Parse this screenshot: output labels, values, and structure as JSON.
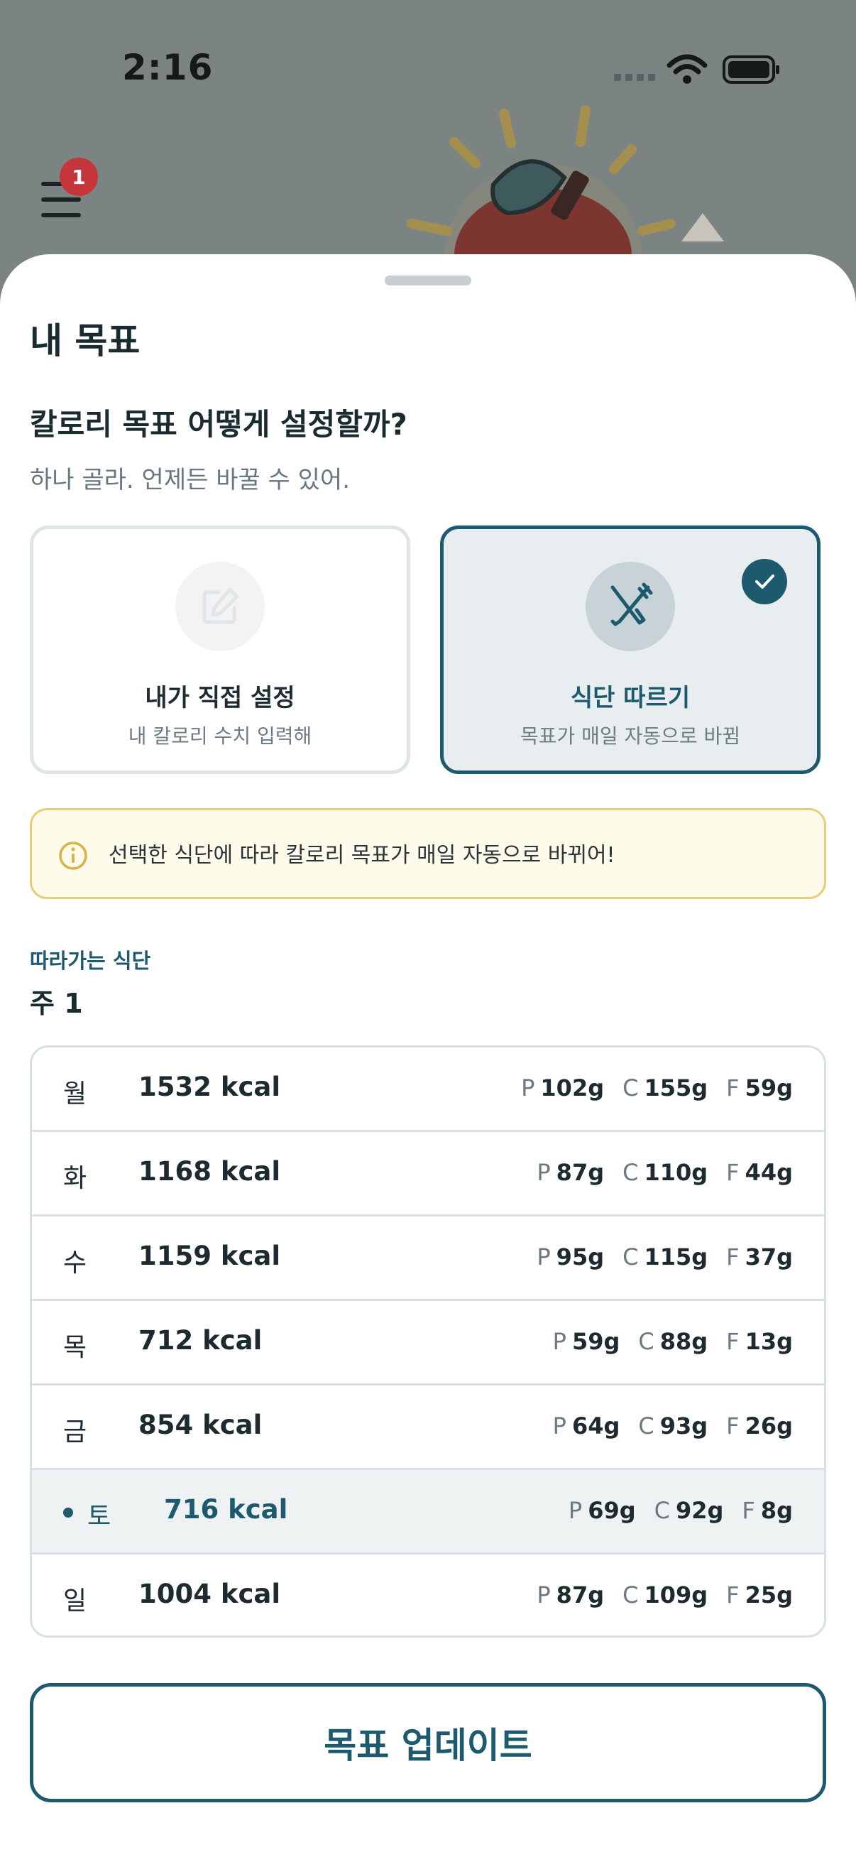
{
  "status_bar": {
    "time": "2:16"
  },
  "menu": {
    "badge_count": "1"
  },
  "sheet": {
    "title": "내 목표",
    "question": "칼로리 목표 어떻게 설정할까?",
    "subtitle": "하나 골라. 언제든 바꿀 수 있어."
  },
  "options": {
    "manual": {
      "title": "내가 직접 설정",
      "subtitle": "내 칼로리 수치 입력해",
      "icon": "edit-icon",
      "selected": false
    },
    "diet": {
      "title": "식단 따르기",
      "subtitle": "목표가 매일 자동으로 바뀜",
      "icon": "utensils-icon",
      "selected": true
    }
  },
  "notice": {
    "text": "선택한 식단에 따라 칼로리 목표가 매일 자동으로 바뀌어!",
    "icon": "info-icon"
  },
  "plan": {
    "label": "따라가는 식단",
    "week": "주 1",
    "days": [
      {
        "day": "월",
        "kcal": "1532 kcal",
        "p": "102g",
        "c": "155g",
        "f": "59g",
        "today": false
      },
      {
        "day": "화",
        "kcal": "1168 kcal",
        "p": "87g",
        "c": "110g",
        "f": "44g",
        "today": false
      },
      {
        "day": "수",
        "kcal": "1159 kcal",
        "p": "95g",
        "c": "115g",
        "f": "37g",
        "today": false
      },
      {
        "day": "목",
        "kcal": "712 kcal",
        "p": "59g",
        "c": "88g",
        "f": "13g",
        "today": false
      },
      {
        "day": "금",
        "kcal": "854 kcal",
        "p": "64g",
        "c": "93g",
        "f": "26g",
        "today": false
      },
      {
        "day": "토",
        "kcal": "716 kcal",
        "p": "69g",
        "c": "92g",
        "f": "8g",
        "today": true
      },
      {
        "day": "일",
        "kcal": "1004 kcal",
        "p": "87g",
        "c": "109g",
        "f": "25g",
        "today": false
      }
    ],
    "macro_keys": {
      "p": "P",
      "c": "C",
      "f": "F"
    }
  },
  "actions": {
    "update_label": "목표 업데이트"
  },
  "colors": {
    "accent": "#1d5a6e",
    "badge": "#c4363a",
    "notice_border": "#e9cd7a",
    "notice_bg": "#fffbeb"
  }
}
